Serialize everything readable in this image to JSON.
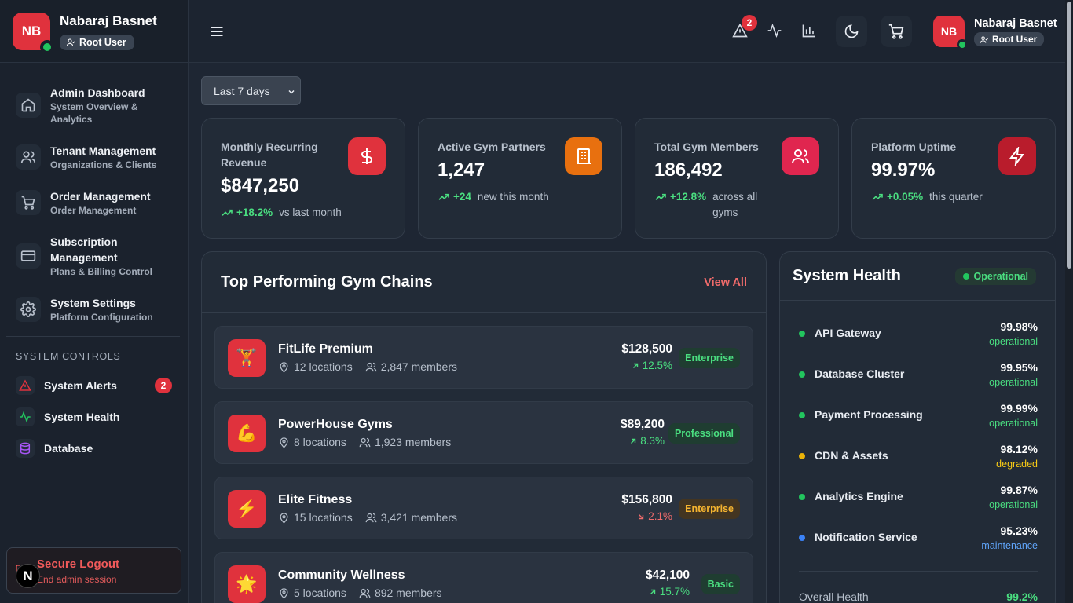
{
  "user": {
    "initials": "NB",
    "name": "Nabaraj Basnet",
    "role": "Root User"
  },
  "sidebar": {
    "nav": [
      {
        "title": "Admin Dashboard",
        "subtitle": "System Overview & Analytics",
        "icon": "home-icon"
      },
      {
        "title": "Tenant Management",
        "subtitle": "Organizations & Clients",
        "icon": "users-icon"
      },
      {
        "title": "Order Management",
        "subtitle": "Order Management",
        "icon": "cart-icon"
      },
      {
        "title": "Subscription Management",
        "subtitle": "Plans & Billing Control",
        "icon": "credit-card-icon"
      },
      {
        "title": "System Settings",
        "subtitle": "Platform Configuration",
        "icon": "gear-icon"
      }
    ],
    "controls_title": "SYSTEM CONTROLS",
    "controls": [
      {
        "label": "System Alerts",
        "badge": "2",
        "icon": "alert-triangle-icon",
        "color": "#e0323d"
      },
      {
        "label": "System Health",
        "icon": "activity-icon",
        "color": "#22c55e"
      },
      {
        "label": "Database",
        "icon": "database-icon",
        "color": "#a855f7"
      }
    ],
    "logout": {
      "title": "Secure Logout",
      "subtitle": "End admin session"
    },
    "dev_badge": "N"
  },
  "topbar": {
    "alerts_count": "2"
  },
  "filters": {
    "range": "Last 7 days"
  },
  "stats": [
    {
      "label": "Monthly Recurring Revenue",
      "value": "$847,250",
      "delta": "+18.2%",
      "note": "vs last month",
      "icon": "dollar-icon",
      "color": "#e0323d"
    },
    {
      "label": "Active Gym Partners",
      "value": "1,247",
      "delta": "+24",
      "note": "new this month",
      "icon": "building-icon",
      "color": "#e8700f"
    },
    {
      "label": "Total Gym Members",
      "value": "186,492",
      "delta": "+12.8%",
      "note": "across all gyms",
      "icon": "users-icon",
      "color": "#e0264f"
    },
    {
      "label": "Platform Uptime",
      "value": "99.97%",
      "delta": "+0.05%",
      "note": "this quarter",
      "icon": "zap-icon",
      "color": "#b91c2c"
    }
  ],
  "chains": {
    "title": "Top Performing Gym Chains",
    "view_all": "View All",
    "rows": [
      {
        "emoji": "🏋️",
        "name": "FitLife Premium",
        "locations": "12 locations",
        "members": "2,847 members",
        "revenue": "$128,500",
        "change": "12.5%",
        "trend": "up",
        "tier": "Enterprise",
        "tier_color": "#4ade80",
        "tier_bg": "#1f3d31"
      },
      {
        "emoji": "💪",
        "name": "PowerHouse Gyms",
        "locations": "8 locations",
        "members": "1,923 members",
        "revenue": "$89,200",
        "change": "8.3%",
        "trend": "up",
        "tier": "Professional",
        "tier_color": "#4ade80",
        "tier_bg": "#1f3d31"
      },
      {
        "emoji": "⚡",
        "name": "Elite Fitness",
        "locations": "15 locations",
        "members": "3,421 members",
        "revenue": "$156,800",
        "change": "2.1%",
        "trend": "down",
        "tier": "Enterprise",
        "tier_color": "#f5b430",
        "tier_bg": "#433521"
      },
      {
        "emoji": "🌟",
        "name": "Community Wellness",
        "locations": "5 locations",
        "members": "892 members",
        "revenue": "$42,100",
        "change": "15.7%",
        "trend": "up",
        "tier": "Basic",
        "tier_color": "#4ade80",
        "tier_bg": "#1f3d31"
      }
    ]
  },
  "health": {
    "title": "System Health",
    "status": "Operational",
    "services": [
      {
        "name": "API Gateway",
        "pct": "99.98%",
        "state": "operational",
        "color": "#22c55e"
      },
      {
        "name": "Database Cluster",
        "pct": "99.95%",
        "state": "operational",
        "color": "#22c55e"
      },
      {
        "name": "Payment Processing",
        "pct": "99.99%",
        "state": "operational",
        "color": "#22c55e"
      },
      {
        "name": "CDN & Assets",
        "pct": "98.12%",
        "state": "degraded",
        "color": "#eab308"
      },
      {
        "name": "Analytics Engine",
        "pct": "99.87%",
        "state": "operational",
        "color": "#22c55e"
      },
      {
        "name": "Notification Service",
        "pct": "95.23%",
        "state": "maintenance",
        "color": "#3b82f6"
      }
    ],
    "overall_label": "Overall Health",
    "overall_value": "99.2%"
  }
}
